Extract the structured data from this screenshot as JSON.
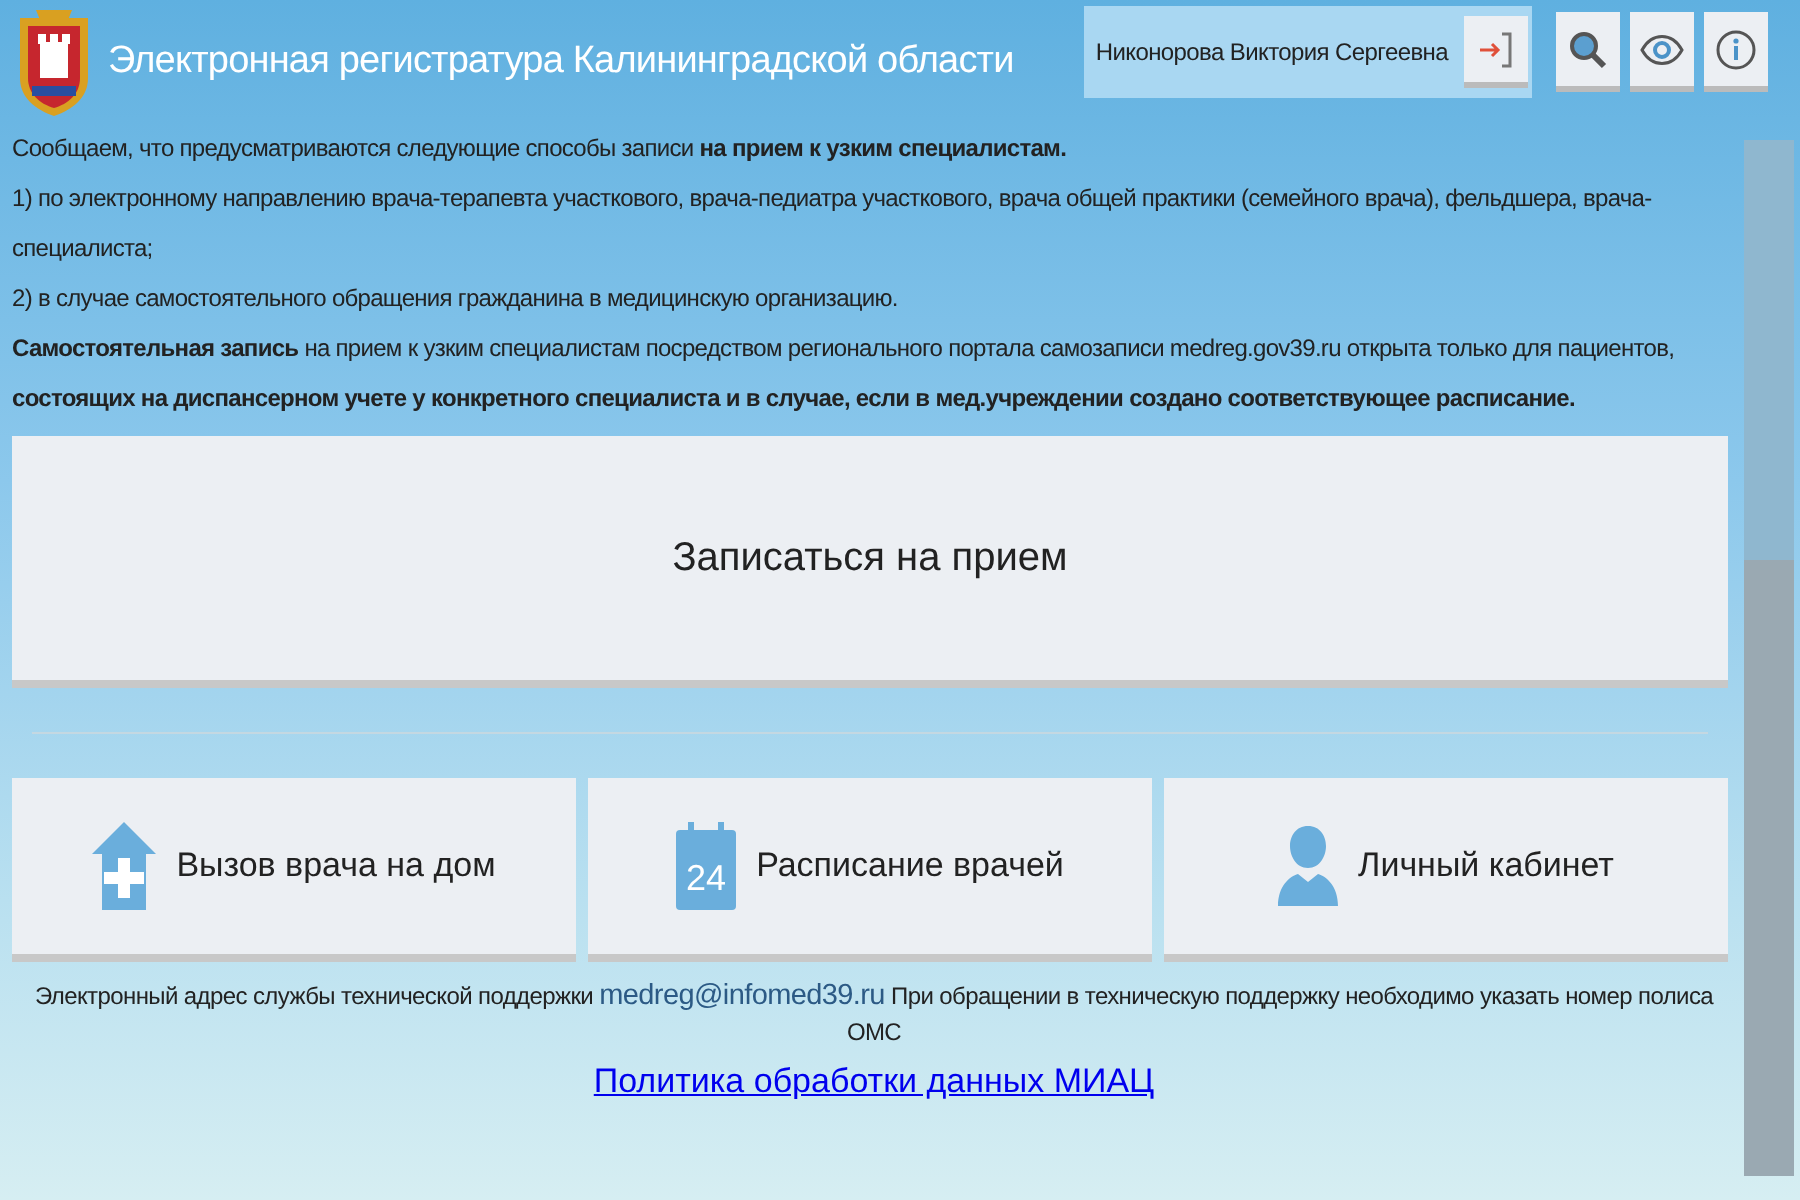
{
  "header": {
    "title": "Электронная регистратура Калининградской области",
    "user_name": "Никонорова Виктория Сергеевна"
  },
  "notice": [
    "Сообщаем, что предусматриваются следующие способы записи **на прием к узким специалистам.**",
    "1) по электронному направлению врача-терапевта участкового, врача-педиатра участкового, врача общей практики (семейного врача), фельдшера, врача-специалиста;",
    "2) в случае самостоятельного обращения гражданина в медицинскую организацию.",
    "**Самостоятельная запись** на прием к узким специалистам посредством регионального портала самозаписи medreg.gov39.ru открыта только для пациентов, **состоящих на диспансерном учете у конкретного специалиста и в случае, если в мед.учреждении создано соответствующее расписание.**"
  ],
  "main_button": "Записаться на прием",
  "tiles": [
    {
      "kind": "house",
      "label": "Вызов врача на дом"
    },
    {
      "kind": "calendar",
      "label": "Расписание врачей",
      "icon_text": "24"
    },
    {
      "kind": "person",
      "label": "Личный кабинет"
    }
  ],
  "footer": {
    "before": "Электронный адрес службы технической поддержки",
    "email": "medreg@infomed39.ru",
    "after": "При обращении в техническую поддержку необходимо указать номер полиса ОМС",
    "policy_link": "Политика обработки данных МИАЦ"
  }
}
